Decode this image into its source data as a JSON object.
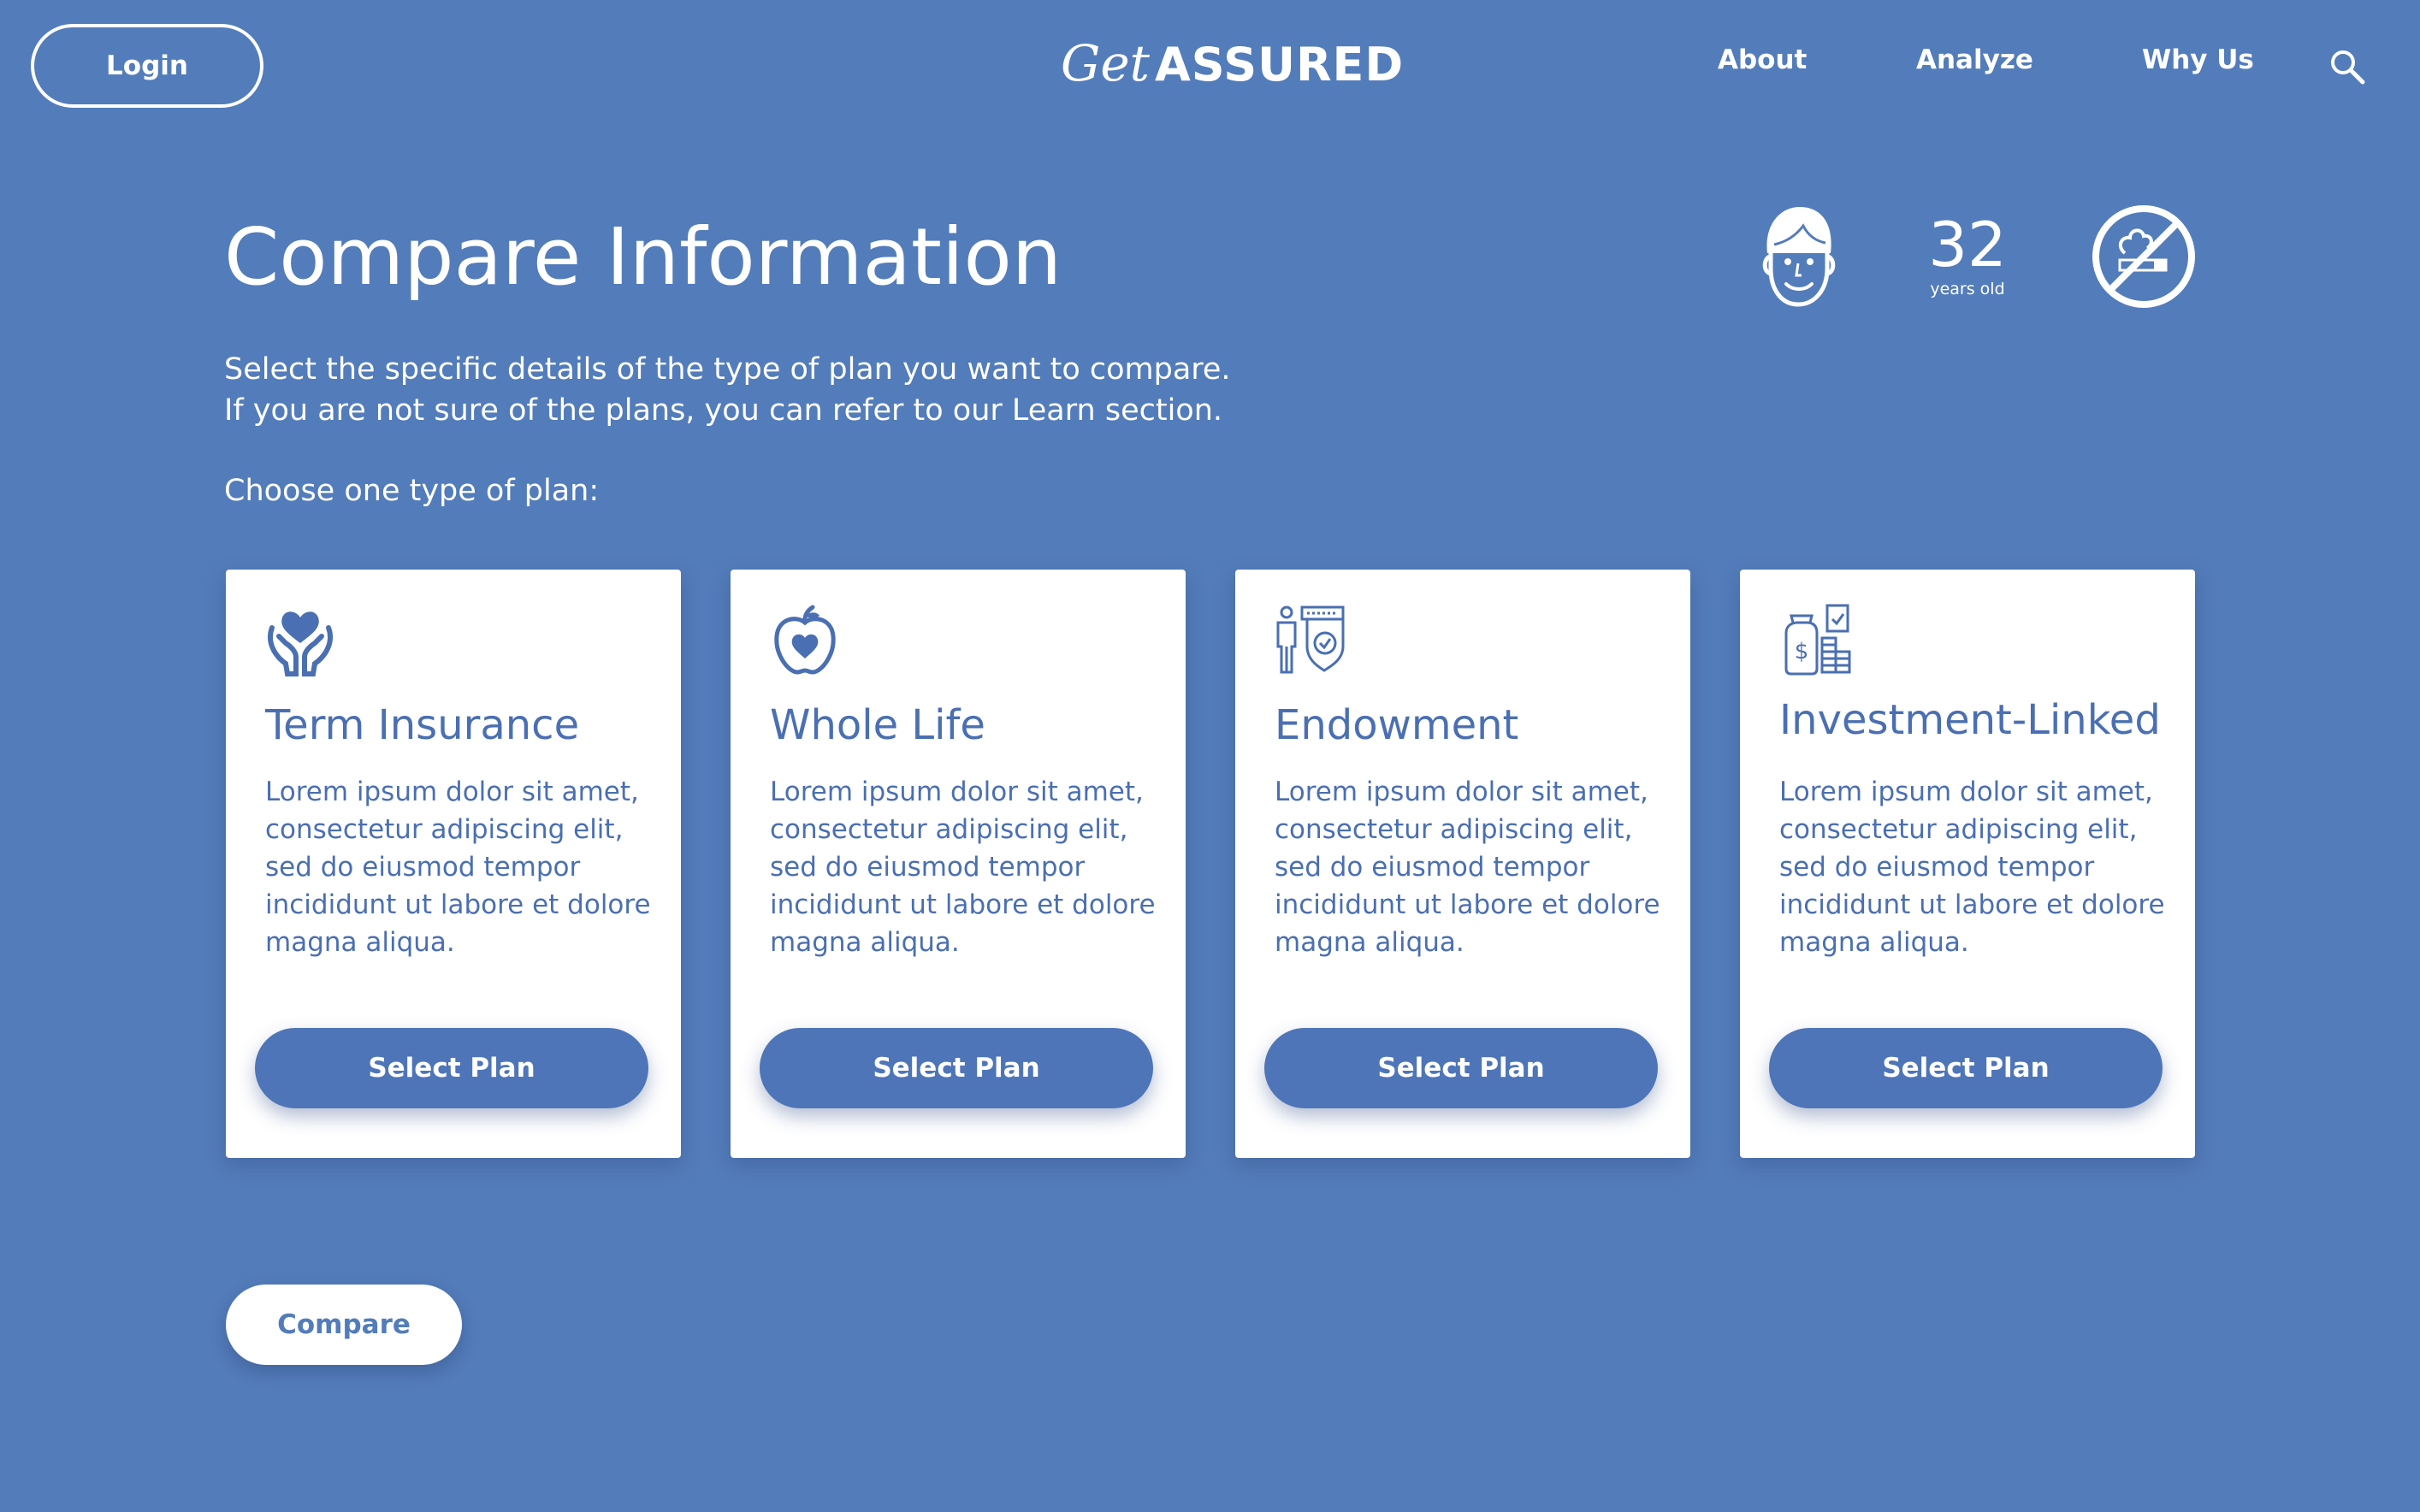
{
  "header": {
    "login_label": "Login",
    "logo_script": "Get",
    "logo_text": "ASSURED",
    "nav": [
      "About",
      "Analyze",
      "Why Us"
    ],
    "search_icon": "search-icon"
  },
  "main": {
    "title": "Compare Information",
    "profile": {
      "avatar_icon": "face-icon",
      "age_value": "32",
      "age_unit": "years old",
      "smoking_icon": "no-smoking-icon"
    },
    "intro_lines": [
      "Select the specific details of the type of plan you want to compare.",
      "If you are not sure of the plans, you can refer to our Learn section."
    ],
    "choose_label": "Choose one type of plan:",
    "plans": [
      {
        "icon": "heart-hands-icon",
        "title": "Term Insurance",
        "description": "Lorem ipsum dolor sit amet, consectetur adipiscing elit, sed do eiusmod tempor incididunt ut labore et dolore magna aliqua.",
        "button_label": "Select Plan"
      },
      {
        "icon": "apple-heart-icon",
        "title": "Whole Life",
        "description": "Lorem ipsum dolor sit amet, consectetur adipiscing elit, sed do eiusmod tempor incididunt ut labore et dolore magna aliqua.",
        "button_label": "Select Plan"
      },
      {
        "icon": "person-shield-icon",
        "title": "Endowment",
        "description": "Lorem ipsum dolor sit amet, consectetur adipiscing elit, sed do eiusmod tempor incididunt ut labore et dolore magna aliqua.",
        "button_label": "Select Plan"
      },
      {
        "icon": "money-bag-coins-icon",
        "title": "Investment-Linked",
        "description": "Lorem ipsum dolor sit amet, consectetur adipiscing elit, sed do eiusmod tempor incididunt ut labore et dolore magna aliqua.",
        "button_label": "Select Plan"
      }
    ],
    "compare_label": "Compare"
  },
  "colors": {
    "background": "#537cba",
    "card_text": "#4a6fb2",
    "button": "#4e75b8",
    "white": "#ffffff"
  }
}
